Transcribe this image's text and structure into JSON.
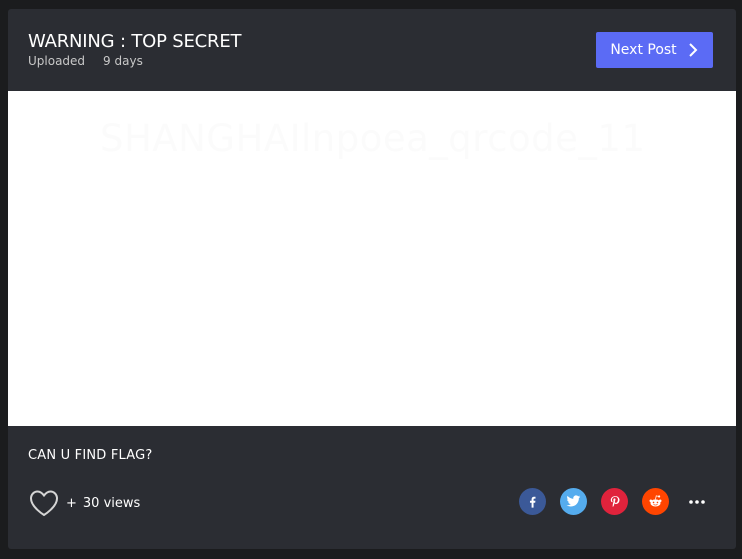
{
  "post": {
    "title": "WARNING : TOP SECRET",
    "uploaded_label": "Uploaded",
    "uploaded_ago": "9 days",
    "next_button_label": "Next Post",
    "image_text": "SHANGHAIlnpoea_qrcode_11",
    "caption": "CAN U FIND FLAG?",
    "views_prefix": "+",
    "views_text": "30 views"
  },
  "share": {
    "icons": [
      "facebook-icon",
      "twitter-icon",
      "pinterest-icon",
      "reddit-icon",
      "more-icon"
    ],
    "colors": {
      "facebook": "#3b5998",
      "twitter": "#55acee",
      "pinterest": "#e0233c",
      "reddit": "#ff4500"
    }
  },
  "colors": {
    "page_bg": "#1b1c1e",
    "card_bg": "#2b2d33",
    "accent": "#5b6bf5"
  }
}
